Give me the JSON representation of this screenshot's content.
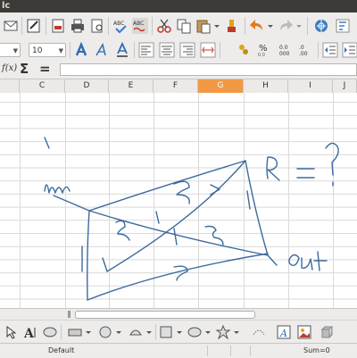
{
  "window": {
    "title": "lc"
  },
  "toolbar": {
    "font_size": "10",
    "font_name": ""
  },
  "formula_bar": {
    "function_wizard_label": "f(x)",
    "sum_label": "Σ",
    "function_label": "=",
    "input_value": ""
  },
  "sheet": {
    "columns": [
      "C",
      "D",
      "E",
      "F",
      "G",
      "H",
      "I",
      "J"
    ],
    "active_column": "G",
    "drawing_annotations": [
      "R = ?",
      "out"
    ]
  },
  "status_bar": {
    "page_style": "Default",
    "sum": "Sum=0"
  },
  "colors": {
    "accent": "#f29946",
    "ink": "#3d6a9e",
    "titlebar": "#3c3b37"
  }
}
